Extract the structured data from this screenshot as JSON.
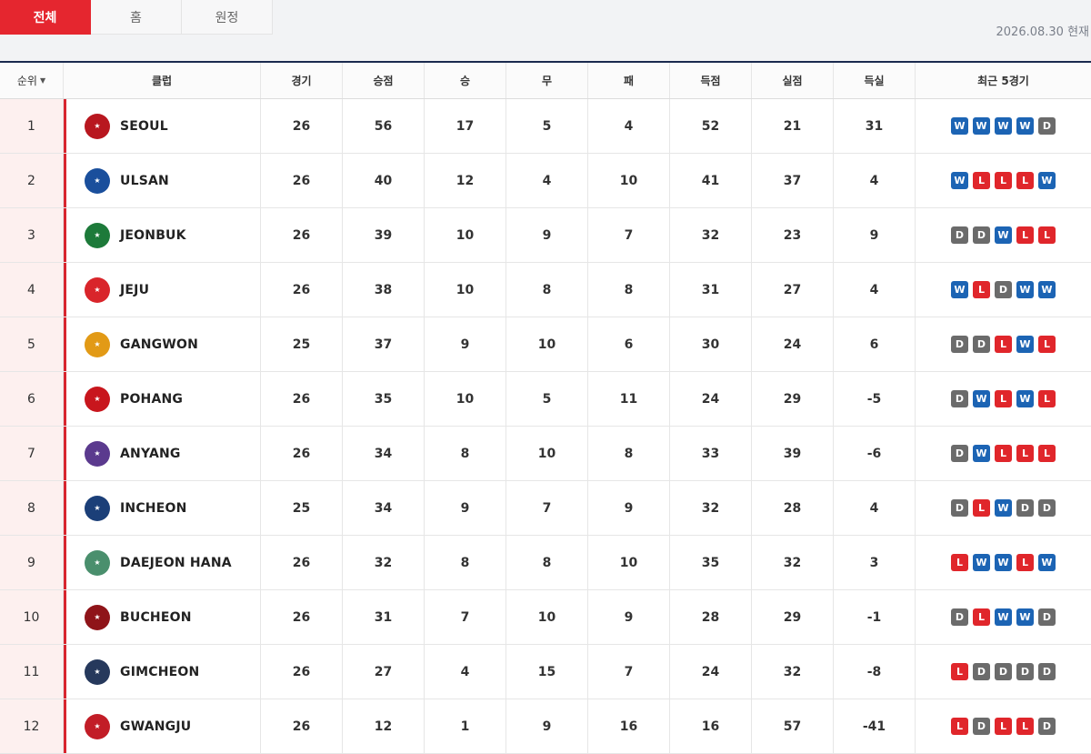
{
  "tabs": [
    {
      "label": "전체",
      "active": true
    },
    {
      "label": "홈",
      "active": false
    },
    {
      "label": "원정",
      "active": false
    }
  ],
  "as_of": "2026.08.30 현재",
  "headers": {
    "rank": "순위",
    "club": "클럽",
    "played": "경기",
    "points": "승점",
    "wins": "승",
    "draws": "무",
    "losses": "패",
    "goals_for": "득점",
    "goals_against": "실점",
    "goal_diff": "득실",
    "recent": "최근 5경기"
  },
  "colors": {
    "accent": "#e5262f",
    "win": "#1c64b4",
    "loss": "#e0262b",
    "draw": "#6b6b6b",
    "header_line": "#1a2a4e"
  },
  "rows": [
    {
      "rank": "1",
      "club": "SEOUL",
      "crest_color": "#b8171f",
      "played": "26",
      "points": "56",
      "wins": "17",
      "draws": "5",
      "losses": "4",
      "gf": "52",
      "ga": "21",
      "gd": "31",
      "form": [
        "W",
        "W",
        "W",
        "W",
        "D"
      ]
    },
    {
      "rank": "2",
      "club": "ULSAN",
      "crest_color": "#1a4f9c",
      "played": "26",
      "points": "40",
      "wins": "12",
      "draws": "4",
      "losses": "10",
      "gf": "41",
      "ga": "37",
      "gd": "4",
      "form": [
        "W",
        "L",
        "L",
        "L",
        "W"
      ]
    },
    {
      "rank": "3",
      "club": "JEONBUK",
      "crest_color": "#1d7a3a",
      "played": "26",
      "points": "39",
      "wins": "10",
      "draws": "9",
      "losses": "7",
      "gf": "32",
      "ga": "23",
      "gd": "9",
      "form": [
        "D",
        "D",
        "W",
        "L",
        "L"
      ]
    },
    {
      "rank": "4",
      "club": "JEJU",
      "crest_color": "#d9252b",
      "played": "26",
      "points": "38",
      "wins": "10",
      "draws": "8",
      "losses": "8",
      "gf": "31",
      "ga": "27",
      "gd": "4",
      "form": [
        "W",
        "L",
        "D",
        "W",
        "W"
      ]
    },
    {
      "rank": "5",
      "club": "GANGWON",
      "crest_color": "#e29a16",
      "played": "25",
      "points": "37",
      "wins": "9",
      "draws": "10",
      "losses": "6",
      "gf": "30",
      "ga": "24",
      "gd": "6",
      "form": [
        "D",
        "D",
        "L",
        "W",
        "L"
      ]
    },
    {
      "rank": "6",
      "club": "POHANG",
      "crest_color": "#c8161d",
      "played": "26",
      "points": "35",
      "wins": "10",
      "draws": "5",
      "losses": "11",
      "gf": "24",
      "ga": "29",
      "gd": "-5",
      "form": [
        "D",
        "W",
        "L",
        "W",
        "L"
      ]
    },
    {
      "rank": "7",
      "club": "ANYANG",
      "crest_color": "#5b3a8e",
      "played": "26",
      "points": "34",
      "wins": "8",
      "draws": "10",
      "losses": "8",
      "gf": "33",
      "ga": "39",
      "gd": "-6",
      "form": [
        "D",
        "W",
        "L",
        "L",
        "L"
      ]
    },
    {
      "rank": "8",
      "club": "INCHEON",
      "crest_color": "#1b3f78",
      "played": "25",
      "points": "34",
      "wins": "9",
      "draws": "7",
      "losses": "9",
      "gf": "32",
      "ga": "28",
      "gd": "4",
      "form": [
        "D",
        "L",
        "W",
        "D",
        "D"
      ]
    },
    {
      "rank": "9",
      "club": "DAEJEON HANA",
      "crest_color": "#4a8f6d",
      "played": "26",
      "points": "32",
      "wins": "8",
      "draws": "8",
      "losses": "10",
      "gf": "35",
      "ga": "32",
      "gd": "3",
      "form": [
        "L",
        "W",
        "W",
        "L",
        "W"
      ]
    },
    {
      "rank": "10",
      "club": "BUCHEON",
      "crest_color": "#8f1419",
      "played": "26",
      "points": "31",
      "wins": "7",
      "draws": "10",
      "losses": "9",
      "gf": "28",
      "ga": "29",
      "gd": "-1",
      "form": [
        "D",
        "L",
        "W",
        "W",
        "D"
      ]
    },
    {
      "rank": "11",
      "club": "GIMCHEON",
      "crest_color": "#26395c",
      "played": "26",
      "points": "27",
      "wins": "4",
      "draws": "15",
      "losses": "7",
      "gf": "24",
      "ga": "32",
      "gd": "-8",
      "form": [
        "L",
        "D",
        "D",
        "D",
        "D"
      ]
    },
    {
      "rank": "12",
      "club": "GWANGJU",
      "crest_color": "#c21d27",
      "played": "26",
      "points": "12",
      "wins": "1",
      "draws": "9",
      "losses": "16",
      "gf": "16",
      "ga": "57",
      "gd": "-41",
      "form": [
        "L",
        "D",
        "L",
        "L",
        "D"
      ]
    }
  ]
}
